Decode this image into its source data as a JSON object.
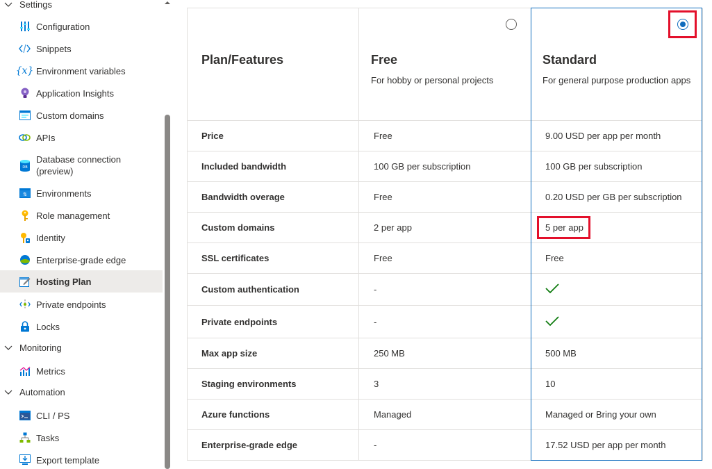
{
  "sidebar": {
    "groups": {
      "settings": "Settings",
      "monitoring": "Monitoring",
      "automation": "Automation"
    },
    "items": {
      "configuration": "Configuration",
      "snippets": "Snippets",
      "env_vars": "Environment variables",
      "app_insights": "Application Insights",
      "custom_domains": "Custom domains",
      "apis": "APIs",
      "db_connection": "Database connection\n(preview)",
      "environments": "Environments",
      "role_mgmt": "Role management",
      "identity": "Identity",
      "edge": "Enterprise-grade edge",
      "hosting_plan": "Hosting Plan",
      "private_endpoints": "Private endpoints",
      "locks": "Locks",
      "metrics": "Metrics",
      "cli_ps": "CLI / PS",
      "tasks": "Tasks",
      "export_template": "Export template"
    },
    "active_item": "Hosting Plan"
  },
  "table": {
    "header": {
      "feature_col": "Plan/Features",
      "free_title": "Free",
      "free_desc": "For hobby or personal projects",
      "standard_title": "Standard",
      "standard_desc": "For general purpose production apps"
    },
    "selected_plan": "Standard",
    "rows": [
      {
        "feature": "Price",
        "free": "Free",
        "standard": "9.00 USD per app per month"
      },
      {
        "feature": "Included bandwidth",
        "free": "100 GB per subscription",
        "standard": "100 GB per subscription"
      },
      {
        "feature": "Bandwidth overage",
        "free": "Free",
        "standard": "0.20 USD per GB per subscription"
      },
      {
        "feature": "Custom domains",
        "free": "2 per app",
        "standard": "5 per app"
      },
      {
        "feature": "SSL certificates",
        "free": "Free",
        "standard": "Free"
      },
      {
        "feature": "Custom authentication",
        "free": "-",
        "standard": "✓"
      },
      {
        "feature": "Private endpoints",
        "free": "-",
        "standard": "✓"
      },
      {
        "feature": "Max app size",
        "free": "250 MB",
        "standard": "500 MB"
      },
      {
        "feature": "Staging environments",
        "free": "3",
        "standard": "10"
      },
      {
        "feature": "Azure functions",
        "free": "Managed",
        "standard": "Managed or Bring your own"
      },
      {
        "feature": "Enterprise-grade edge",
        "free": "-",
        "standard": "17.52 USD per app per month"
      }
    ]
  },
  "colors": {
    "accent": "#0f6cbd",
    "highlight": "#e3102b",
    "check": "#107c10",
    "active_bg": "#edebe9"
  }
}
